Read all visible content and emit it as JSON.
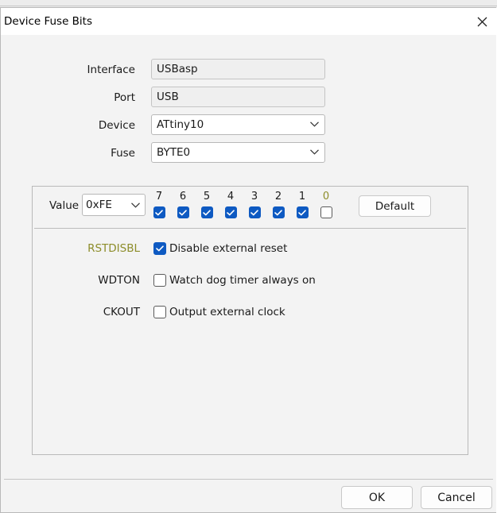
{
  "window": {
    "title": "Device Fuse Bits"
  },
  "form": {
    "interface": {
      "label": "Interface",
      "value": "USBasp"
    },
    "port": {
      "label": "Port",
      "value": "USB"
    },
    "device": {
      "label": "Device",
      "value": "ATtiny10"
    },
    "fuse": {
      "label": "Fuse",
      "value": "BYTE0"
    }
  },
  "value_section": {
    "label": "Value",
    "value": "0xFE",
    "default_label": "Default",
    "bits": [
      {
        "num": "7",
        "checked": true,
        "highlight": false
      },
      {
        "num": "6",
        "checked": true,
        "highlight": false
      },
      {
        "num": "5",
        "checked": true,
        "highlight": false
      },
      {
        "num": "4",
        "checked": true,
        "highlight": false
      },
      {
        "num": "3",
        "checked": true,
        "highlight": false
      },
      {
        "num": "2",
        "checked": true,
        "highlight": false
      },
      {
        "num": "1",
        "checked": true,
        "highlight": false
      },
      {
        "num": "0",
        "checked": false,
        "highlight": true
      }
    ]
  },
  "fuses": [
    {
      "name": "RSTDISBL",
      "desc": "Disable external reset",
      "checked": true,
      "highlight": true
    },
    {
      "name": "WDTON",
      "desc": "Watch dog timer always on",
      "checked": false,
      "highlight": false
    },
    {
      "name": "CKOUT",
      "desc": "Output external clock",
      "checked": false,
      "highlight": false
    }
  ],
  "buttons": {
    "ok": "OK",
    "cancel": "Cancel"
  },
  "colors": {
    "accent": "#0e5ac2",
    "highlight_text": "#8d8d2a",
    "dialog_bg": "#f3f3f3"
  }
}
